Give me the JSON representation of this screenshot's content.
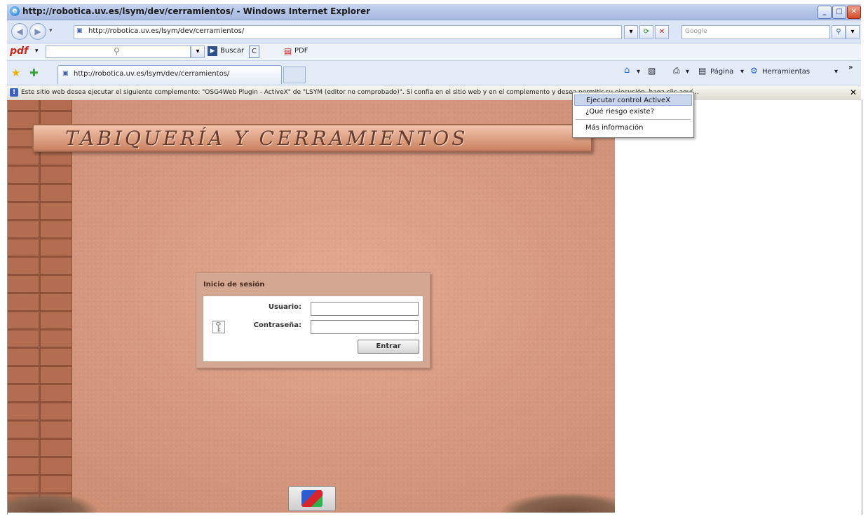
{
  "window": {
    "title": "http://robotica.uv.es/lsym/dev/cerramientos/ - Windows Internet Explorer",
    "minimize": "_",
    "maximize": "□",
    "close": "✕"
  },
  "address_bar": {
    "url": "http://robotica.uv.es/lsym/dev/cerramientos/",
    "search_placeholder": "Google"
  },
  "pdf_toolbar": {
    "logo": "pdf",
    "buscar": "Buscar",
    "c": "C",
    "pdf": "PDF"
  },
  "tabs": [
    {
      "label": "http://robotica.uv.es/lsym/dev/cerramientos/"
    }
  ],
  "command_bar": {
    "pagina": "Página",
    "herramientas": "Herramientas"
  },
  "info_bar": {
    "text": "Este sitio web desea ejecutar el siguiente complemento: \"OSG4Web Plugin - ActiveX\" de \"LSYM (editor no comprobado)\". Si confía en el sitio web y en el complemento y desea permitir su ejecución, haga clic aquí..."
  },
  "context_menu": {
    "items": [
      "Ejecutar control ActiveX",
      "¿Qué riesgo existe?",
      "Más información"
    ]
  },
  "page": {
    "banner": "TABIQUERÍA Y CERRAMIENTOS",
    "login": {
      "title": "Inicio de sesión",
      "user_label": "Usuario:",
      "password_label": "Contraseña:",
      "submit": "Entrar"
    }
  }
}
